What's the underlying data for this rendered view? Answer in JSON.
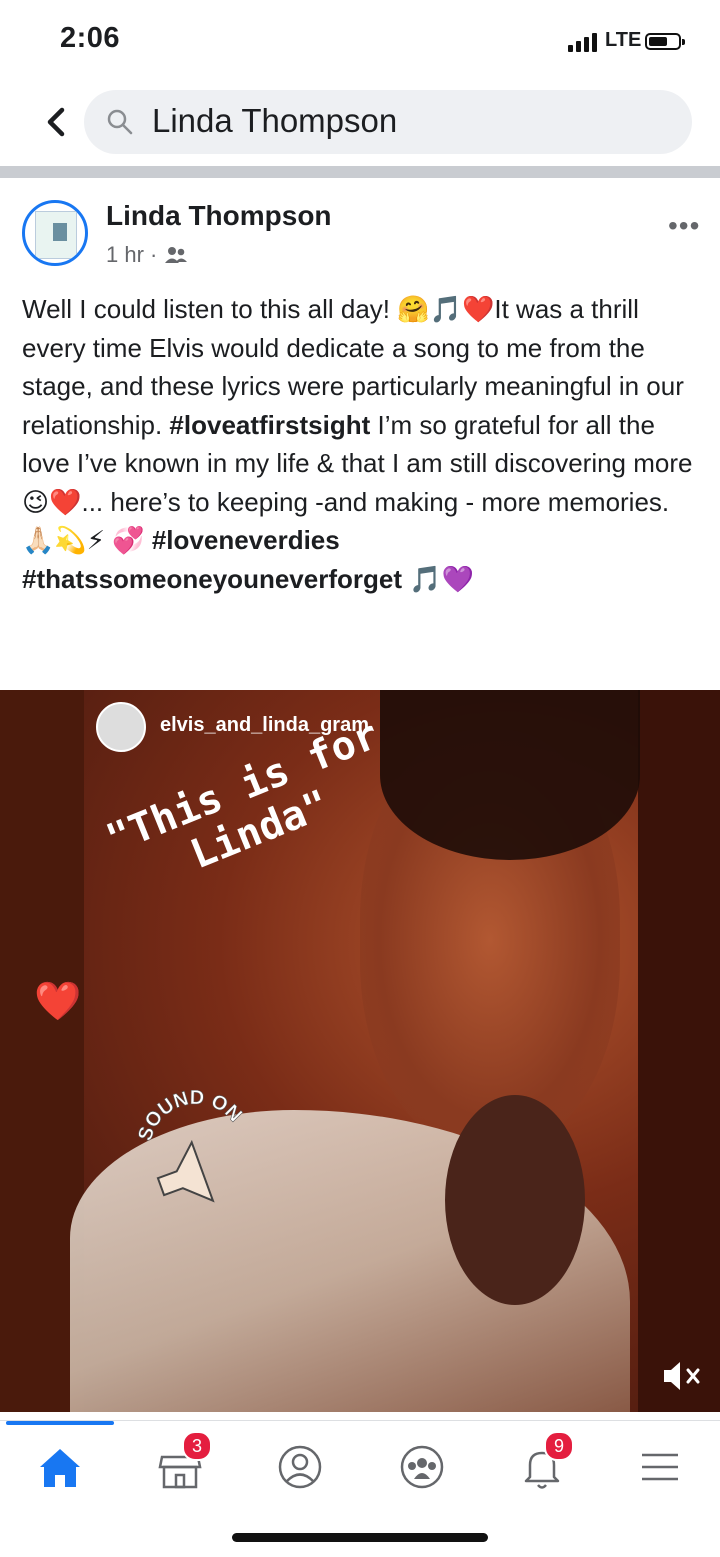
{
  "status_bar": {
    "time": "2:06",
    "network": "LTE",
    "battery_level": 0.55
  },
  "search": {
    "query": "Linda Thompson"
  },
  "post": {
    "author": "Linda Thompson",
    "timestamp": "1 hr ·",
    "audience_icon": "friends-icon",
    "text_segments": [
      {
        "text": "Well I could listen to this all day! 🤗🎵❤️It was a thrill every time Elvis would dedicate a song to me from the stage, and these lyrics were particularly meaningful in our relationship. ",
        "bold": false
      },
      {
        "text": "#loveatfirstsight",
        "bold": true
      },
      {
        "text": " I’m so grateful for all the love I’ve known in my life & that I am still discovering more 😉❤️... here’s to keeping -and making - more memories. 🙏🏻💫⚡ 💞 ",
        "bold": false
      },
      {
        "text": "#loveneverdies",
        "bold": true
      },
      {
        "text": " ",
        "bold": false
      },
      {
        "text": "#thatssomeoneyouneverforget",
        "bold": true
      },
      {
        "text": " 🎵💜",
        "bold": false
      }
    ]
  },
  "video": {
    "instagram_handle": "elvis_and_linda_gram",
    "caption_line1": "\"This is for",
    "caption_line2": "   Linda\"",
    "sticker_heart": "❤️",
    "sound_sticker_text": "SOUND ON",
    "muted": true
  },
  "bottom_nav": {
    "active": "home",
    "items": [
      {
        "name": "home",
        "icon": "home-icon",
        "badge": ""
      },
      {
        "name": "marketplace",
        "icon": "marketplace-icon",
        "badge": "3"
      },
      {
        "name": "profile",
        "icon": "profile-icon",
        "badge": ""
      },
      {
        "name": "groups",
        "icon": "groups-icon",
        "badge": ""
      },
      {
        "name": "notifications",
        "icon": "bell-icon",
        "badge": "9"
      },
      {
        "name": "menu",
        "icon": "menu-icon",
        "badge": ""
      }
    ]
  },
  "colors": {
    "accent": "#1877f2",
    "badge": "#e41e3f",
    "secondary_text": "#65676b"
  }
}
